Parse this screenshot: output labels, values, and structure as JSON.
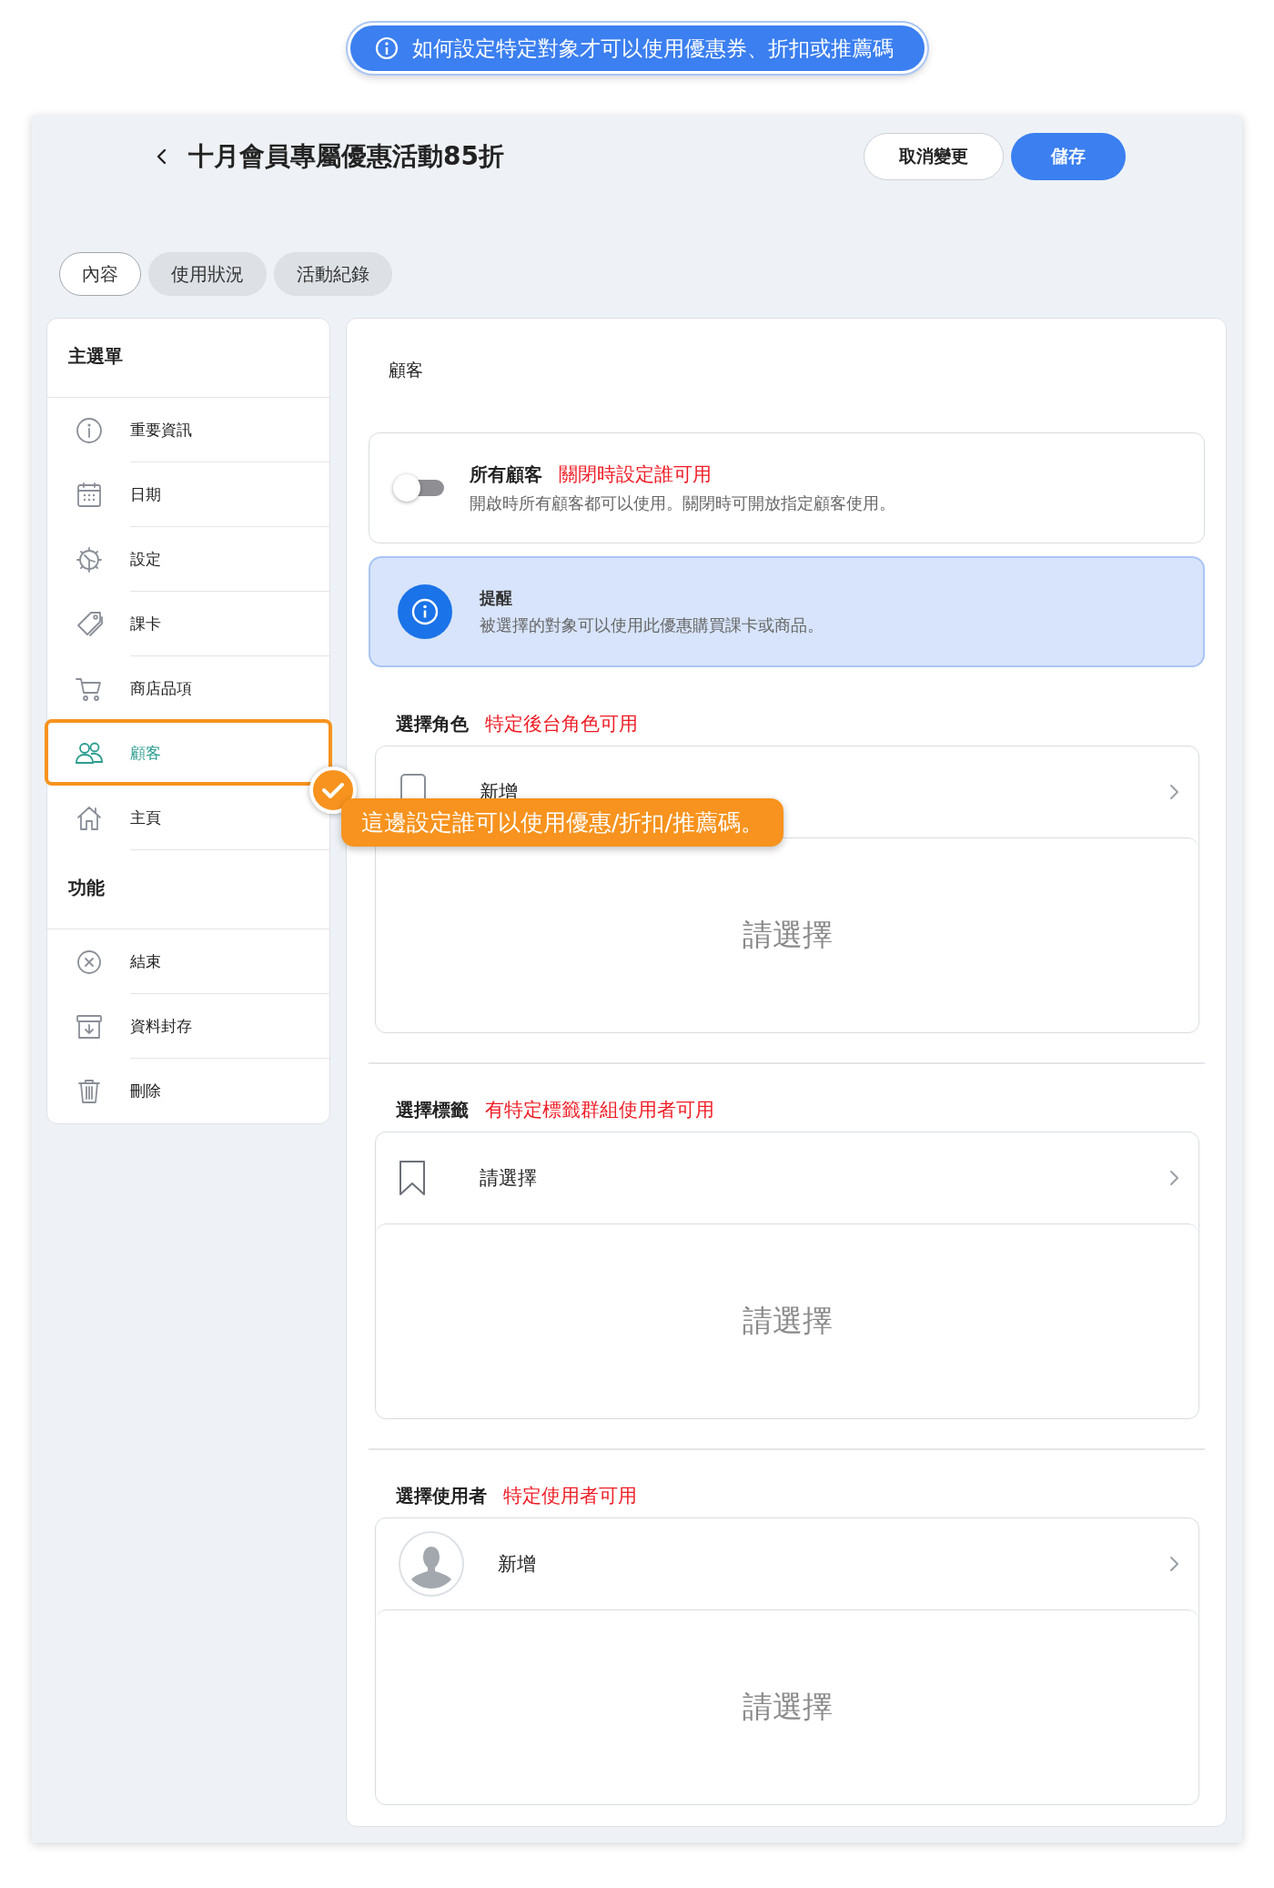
{
  "banner": {
    "text": "如何設定特定對象才可以使用優惠券、折扣或推薦碼"
  },
  "header": {
    "title": "十月會員專屬優惠活動85折",
    "buttons": [
      {
        "label": "取消變更",
        "kind": "secondary"
      },
      {
        "label": "儲存",
        "kind": "primary"
      }
    ]
  },
  "tabs": [
    {
      "label": "內容",
      "selected": true
    },
    {
      "label": "使用狀況",
      "selected": false
    },
    {
      "label": "活動紀錄",
      "selected": false
    }
  ],
  "sidebar": {
    "sections": [
      {
        "title": "主選單",
        "items": [
          {
            "label": "重要資訊",
            "selected": false
          },
          {
            "label": "日期",
            "selected": false
          },
          {
            "label": "設定",
            "selected": false
          },
          {
            "label": "課卡",
            "selected": false
          },
          {
            "label": "商店品項",
            "selected": false
          },
          {
            "label": "顧客",
            "selected": true
          },
          {
            "label": "主頁",
            "selected": false
          }
        ]
      },
      {
        "title": "功能",
        "items": [
          {
            "label": "結束",
            "selected": false
          },
          {
            "label": "資料封存",
            "selected": false
          },
          {
            "label": "刪除",
            "selected": false
          }
        ]
      }
    ]
  },
  "callout": {
    "text": "這邊設定誰可以使用優惠/折扣/推薦碼。"
  },
  "panel": {
    "title": "顧客",
    "toggle": {
      "label": "所有顧客",
      "annotation": "關閉時設定誰可用",
      "description": "開啟時所有顧客都可以使用。關閉時可開放指定顧客使用。",
      "on": false
    },
    "alert": {
      "title": "提醒",
      "text": "被選擇的對象可以使用此優惠購買課卡或商品。"
    },
    "selectors": [
      {
        "label": "選擇角色",
        "annotation": "特定後台角色可用",
        "kind": "role",
        "row_text": "新增",
        "empty_text": "請選擇"
      },
      {
        "label": "選擇標籤",
        "annotation": "有特定標籤群組使用者可用",
        "kind": "tag",
        "row_text": "請選擇",
        "empty_text": "請選擇"
      },
      {
        "label": "選擇使用者",
        "annotation": "特定使用者可用",
        "kind": "user",
        "row_text": "新增",
        "empty_text": "請選擇"
      }
    ]
  }
}
